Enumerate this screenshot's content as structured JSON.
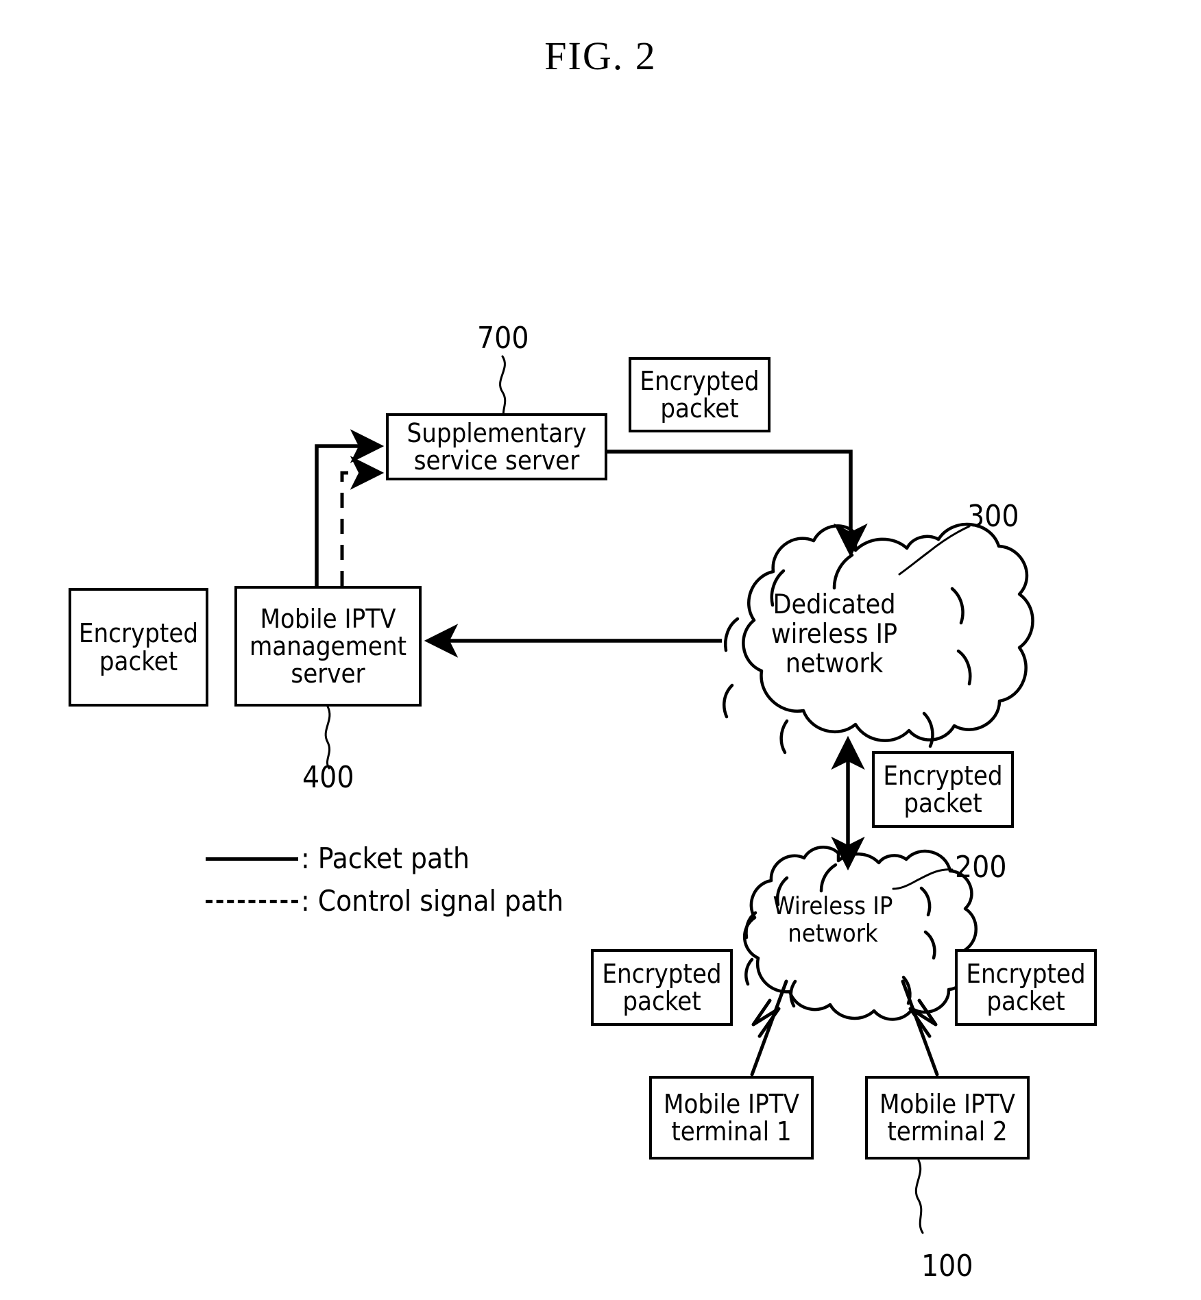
{
  "figure": {
    "title": "FIG. 2"
  },
  "nodes": {
    "supplementary_server": {
      "line1": "Supplementary",
      "line2": "service server",
      "ref": "700"
    },
    "management_server": {
      "line1": "Mobile IPTV",
      "line2": "management",
      "line3": "server",
      "ref": "400"
    },
    "dedicated_cloud": {
      "line1": "Dedicated",
      "line2": "wireless IP",
      "line3": "network",
      "ref": "300"
    },
    "wireless_cloud": {
      "line1": "Wireless IP",
      "line2": "network",
      "ref": "200"
    },
    "terminal_1": {
      "line1": "Mobile IPTV",
      "line2": "terminal 1"
    },
    "terminal_2": {
      "line1": "Mobile IPTV",
      "line2": "terminal 2",
      "ref": "100"
    }
  },
  "packet_boxes": {
    "top": {
      "line1": "Encrypted",
      "line2": "packet"
    },
    "left": {
      "line1": "Encrypted",
      "line2": "packet"
    },
    "middle": {
      "line1": "Encrypted",
      "line2": "packet"
    },
    "bottom_left": {
      "line1": "Encrypted",
      "line2": "packet"
    },
    "bottom_right": {
      "line1": "Encrypted",
      "line2": "packet"
    }
  },
  "legend": {
    "items": [
      {
        "style": "solid",
        "label": ": Packet path"
      },
      {
        "style": "dashed",
        "label": ": Control signal path"
      }
    ]
  },
  "colors": {
    "ink": "#000000",
    "background": "#ffffff"
  }
}
